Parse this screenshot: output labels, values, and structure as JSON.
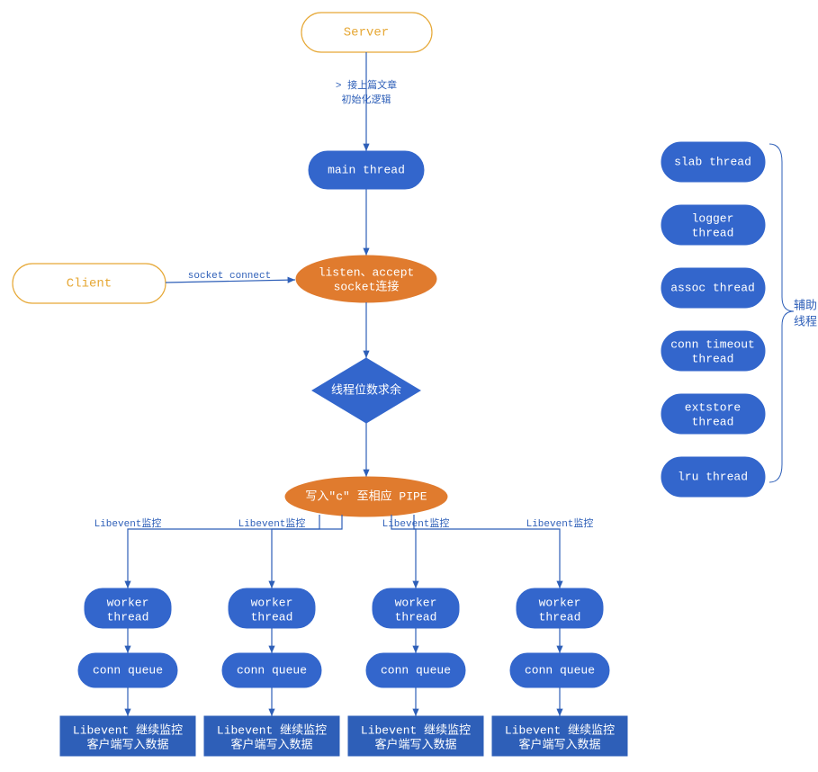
{
  "nodes": {
    "server": "Server",
    "client": "Client",
    "main_thread": "main thread",
    "listen_accept": [
      "listen、accept",
      "socket连接"
    ],
    "remainder": "线程位数求余",
    "write_pipe": "写入\"c\" 至相应 PIPE",
    "worker": [
      "worker",
      "thread"
    ],
    "conn_queue": "conn queue",
    "libevent_box": [
      "Libevent 继续监控",
      "客户端写入数据"
    ]
  },
  "edges": {
    "init": [
      "> 接上篇文章",
      "初始化逻辑"
    ],
    "socket_connect": "socket connect",
    "libevent_watch": "Libevent监控"
  },
  "aux_threads": [
    "slab thread",
    "logger\nthread",
    "assoc thread",
    "conn timeout\nthread",
    "extstore\nthread",
    "lru thread"
  ],
  "aux_label": [
    "辅助",
    "线程"
  ],
  "worker_count": 4
}
